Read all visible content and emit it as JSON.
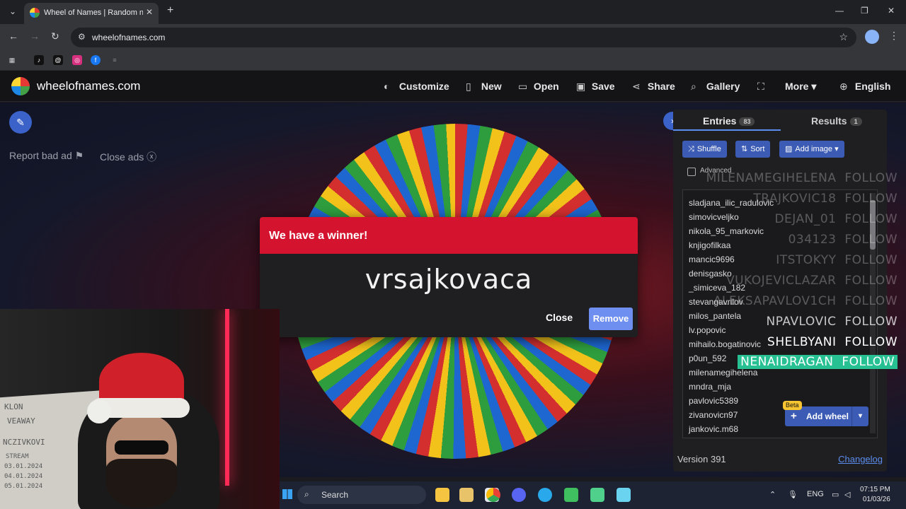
{
  "browser": {
    "tab_title": "Wheel of Names | Random nam",
    "url": "wheelofnames.com"
  },
  "site": {
    "logo_text": "wheelofnames.com",
    "menu": {
      "customize": "Customize",
      "new": "New",
      "open": "Open",
      "save": "Save",
      "share": "Share",
      "gallery": "Gallery",
      "more": "More",
      "language": "English"
    },
    "report_ad": "Report bad ad",
    "close_ads": "Close ads"
  },
  "panel": {
    "entries_label": "Entries",
    "entries_count": "83",
    "results_label": "Results",
    "results_count": "1",
    "shuffle": "Shuffle",
    "sort": "Sort",
    "add_image": "Add image",
    "advanced": "Advanced",
    "entries": [
      "sladjana_ilic_radulovic",
      "simovicveljko",
      "nikola_95_markovic",
      "knjigofilkaa",
      "mancic9696",
      "denisgasko",
      "_simiceva_182",
      "stevangavrilov",
      "milos_pantela",
      "lv.popovic",
      "mihailo.bogatinovic",
      "p0un_592",
      "milenamegihelena",
      "mndra_mja",
      "pavlovic5389",
      "zivanovicn97",
      "jankovic.m68"
    ],
    "add_wheel": "Add wheel",
    "beta": "Beta",
    "version": "Version 391",
    "changelog": "Changelog"
  },
  "follow_overlay": [
    {
      "name": "MILENAMEGIHELENA",
      "action": "FOLLOW"
    },
    {
      "name": "TRAJKOVIC18",
      "action": "FOLLOW"
    },
    {
      "name": "DEJAN_01",
      "action": "FOLLOW"
    },
    {
      "name": "034123",
      "action": "FOLLOW"
    },
    {
      "name": "ITSTOKYY",
      "action": "FOLLOW"
    },
    {
      "name": "VUKOJEVICLAZAR",
      "action": "FOLLOW"
    },
    {
      "name": "ALEKSAPAVLOV1CH",
      "action": "FOLLOW"
    },
    {
      "name": "NPAVLOVIC",
      "action": "FOLLOW"
    },
    {
      "name": "SHELBYANI",
      "action": "FOLLOW"
    },
    {
      "name": "NENAIDRAGAN",
      "action": "FOLLOW"
    }
  ],
  "modal": {
    "title": "We have a winner!",
    "winner": "vrsajkovaca",
    "close": "Close",
    "remove": "Remove"
  },
  "webcam_board": [
    "KLON",
    "VEAWAY",
    "NCZIVKOVI",
    "STREAM",
    "03.01.2024",
    "04.01.2024",
    "05.01.2024"
  ],
  "taskbar": {
    "search": "Search",
    "lang": "ENG",
    "time": "07:15 PM",
    "date": "01/03/26"
  },
  "colors": {
    "modal_header": "#d4132e",
    "accent_blue": "#3b5bb5",
    "remove_button": "#6e8ff0",
    "follow_highlight": "#27c093"
  },
  "icons": [
    "pencil-icon",
    "flag-icon",
    "close-circle-icon",
    "palette-icon",
    "file-icon",
    "folder-icon",
    "floppy-icon",
    "share-icon",
    "search-icon",
    "fullscreen-icon",
    "globe-icon",
    "shuffle-icon",
    "sort-icon",
    "image-icon",
    "chevron-right-icon"
  ]
}
